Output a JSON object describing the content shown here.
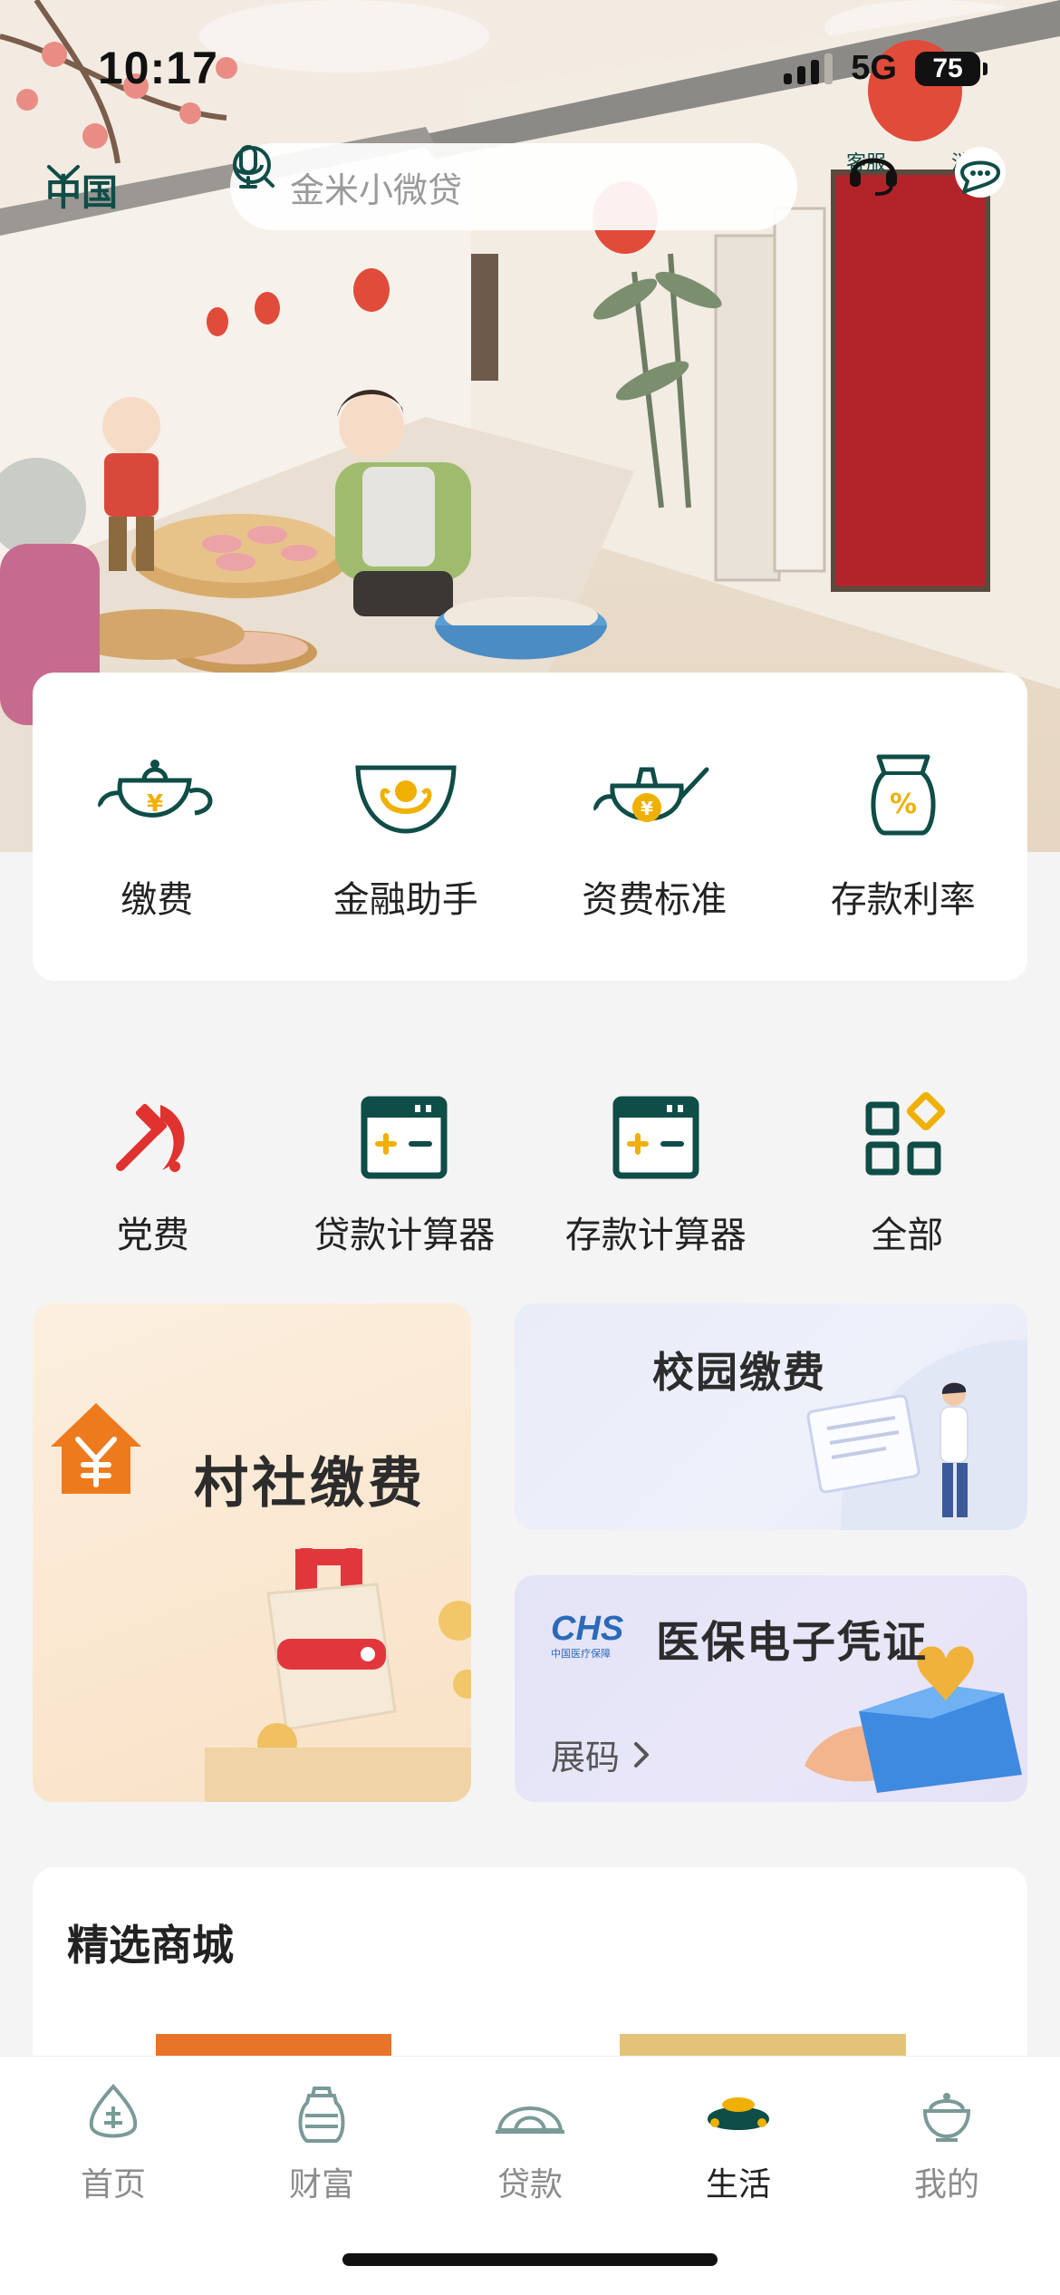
{
  "status": {
    "time": "10:17",
    "network": "5G",
    "battery": "75"
  },
  "header": {
    "region": "中国",
    "search_placeholder": "金米小微贷",
    "service_label": "客服",
    "message_label": "消息"
  },
  "quick_actions": [
    {
      "label": "缴费",
      "icon": "teapot-yuan-icon"
    },
    {
      "label": "金融助手",
      "icon": "bowl-hands-icon"
    },
    {
      "label": "资费标准",
      "icon": "kettle-yuan-icon"
    },
    {
      "label": "存款利率",
      "icon": "percent-bag-icon"
    }
  ],
  "services": [
    {
      "label": "党费",
      "icon": "hammer-sickle-icon"
    },
    {
      "label": "贷款计算器",
      "icon": "calculator-icon"
    },
    {
      "label": "存款计算器",
      "icon": "calculator-icon"
    },
    {
      "label": "全部",
      "icon": "grid-icon"
    }
  ],
  "promos": {
    "village": {
      "title": "村社缴费"
    },
    "campus": {
      "title": "校园缴费"
    },
    "medical": {
      "title": "医保电子凭证",
      "link": "展码",
      "logo": "CHS",
      "logo_sub": "中国医疗保障"
    }
  },
  "mall": {
    "title": "精选商城"
  },
  "tabs": [
    {
      "label": "首页",
      "icon": "home-drop-icon",
      "active": false
    },
    {
      "label": "财富",
      "icon": "jar-icon",
      "active": false
    },
    {
      "label": "贷款",
      "icon": "arch-icon",
      "active": false
    },
    {
      "label": "生活",
      "icon": "pouch-icon",
      "active": true
    },
    {
      "label": "我的",
      "icon": "tureen-icon",
      "active": false
    }
  ],
  "colors": {
    "brand": "#0f4d47",
    "accent": "#f0b000",
    "red": "#e0322f"
  }
}
